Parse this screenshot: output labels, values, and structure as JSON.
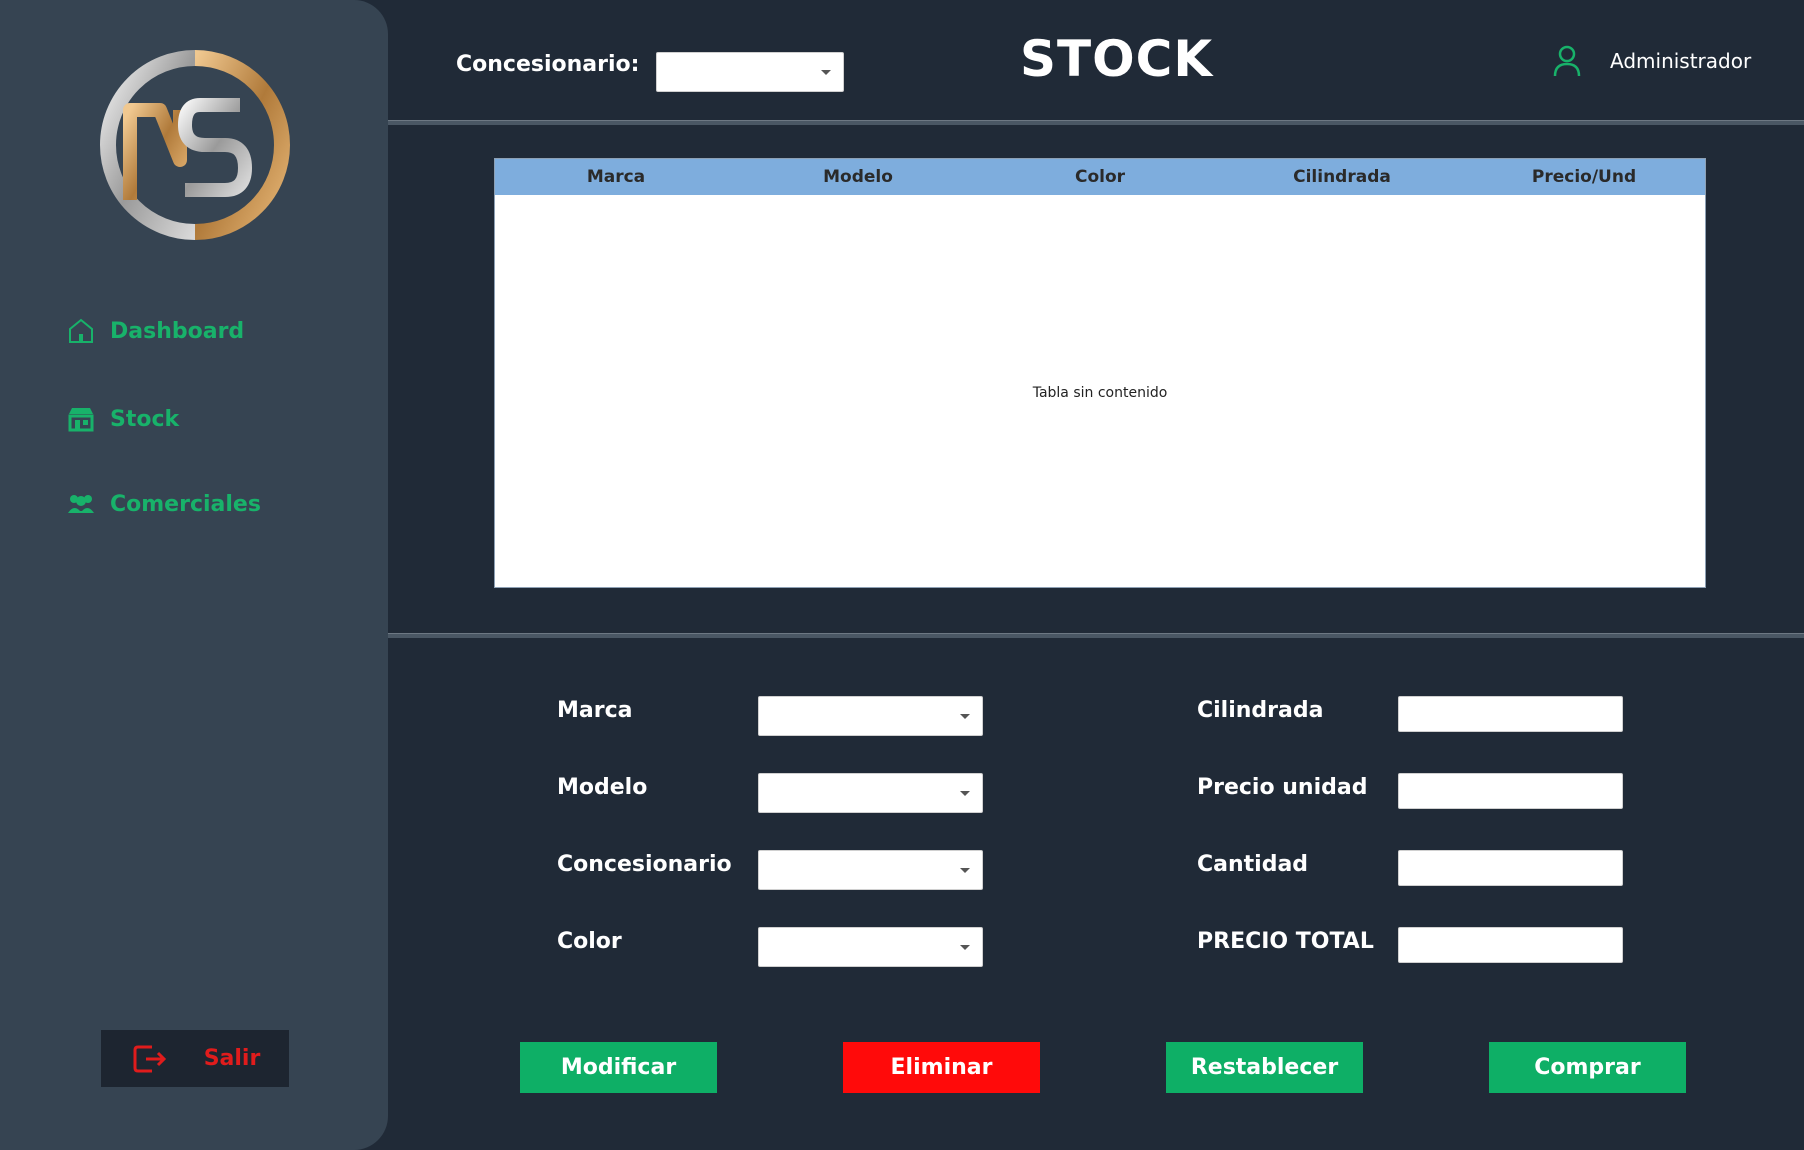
{
  "sidebar": {
    "logo_alt": "MS",
    "items": [
      {
        "label": "Dashboard",
        "icon": "home-icon"
      },
      {
        "label": "Stock",
        "icon": "store-icon"
      },
      {
        "label": "Comerciales",
        "icon": "users-icon"
      }
    ],
    "logout_label": "Salir"
  },
  "header": {
    "concesionario_label": "Concesionario:",
    "concesionario_value": "",
    "title": "STOCK",
    "user_name": "Administrador"
  },
  "table": {
    "columns": [
      "Marca",
      "Modelo",
      "Color",
      "Cilindrada",
      "Precio/Und"
    ],
    "rows": [],
    "empty_text": "Tabla sin contenido"
  },
  "form": {
    "left": [
      {
        "label": "Marca",
        "value": ""
      },
      {
        "label": "Modelo",
        "value": ""
      },
      {
        "label": "Concesionario",
        "value": ""
      },
      {
        "label": "Color",
        "value": ""
      }
    ],
    "right": [
      {
        "label": "Cilindrada",
        "value": ""
      },
      {
        "label": "Precio unidad",
        "value": ""
      },
      {
        "label": "Cantidad",
        "value": ""
      },
      {
        "label": "PRECIO TOTAL",
        "value": ""
      }
    ]
  },
  "buttons": {
    "modificar": "Modificar",
    "eliminar": "Eliminar",
    "restablecer": "Restablecer",
    "comprar": "Comprar"
  },
  "colors": {
    "accent_green": "#0eaf66",
    "danger_red": "#ff0a0a",
    "background": "#202a37",
    "sidebar": "#364452",
    "table_header": "#7eaddd"
  }
}
